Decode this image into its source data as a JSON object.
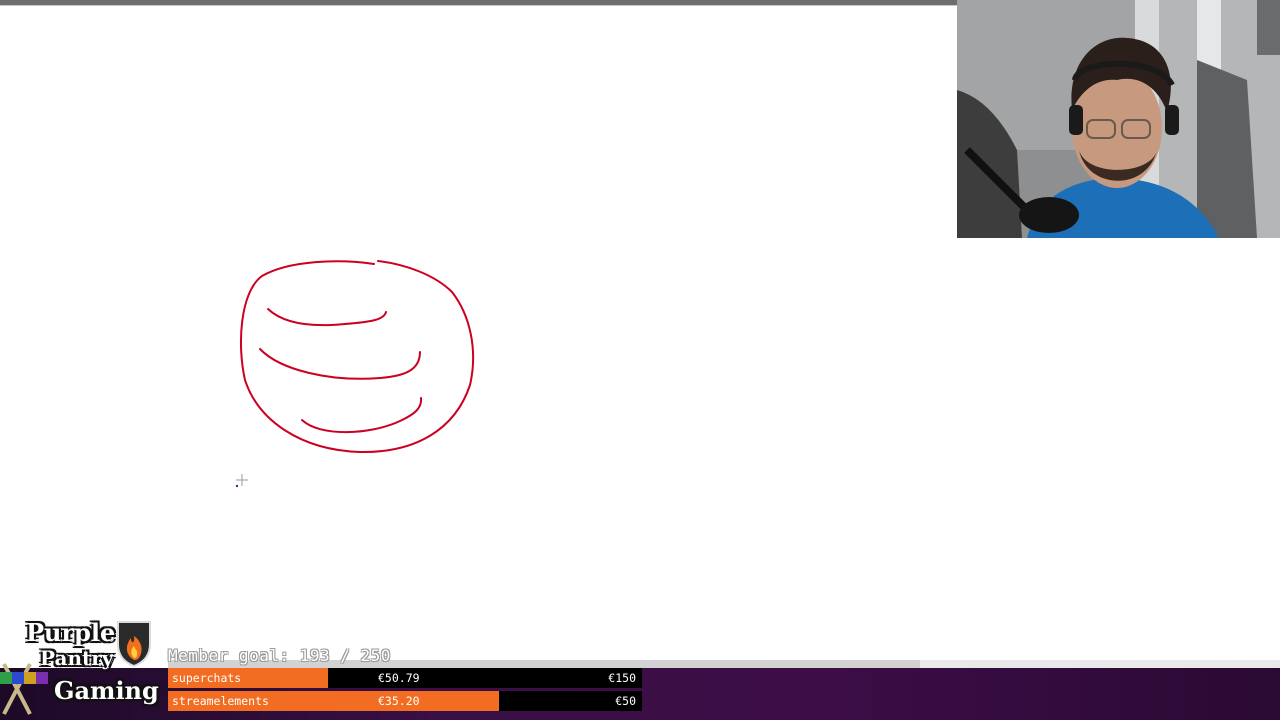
{
  "member_goal": {
    "label": "Member goal: 193 / 250",
    "current": 193,
    "target": 250
  },
  "goals": [
    {
      "name": "superchats",
      "amount": "€50.79",
      "target": "€150",
      "progress": 0.339
    },
    {
      "name": "streamelements",
      "amount": "€35.20",
      "target": "€50",
      "progress": 0.704
    }
  ],
  "logo": {
    "line1": "Purple",
    "line2": "Pantry",
    "line3": "Gaming",
    "emblem": "flame-shield-icon"
  },
  "colors": {
    "drawing_stroke": "#cc0022",
    "goal_fill": "#f26d21",
    "strip": "#3a0f46"
  }
}
